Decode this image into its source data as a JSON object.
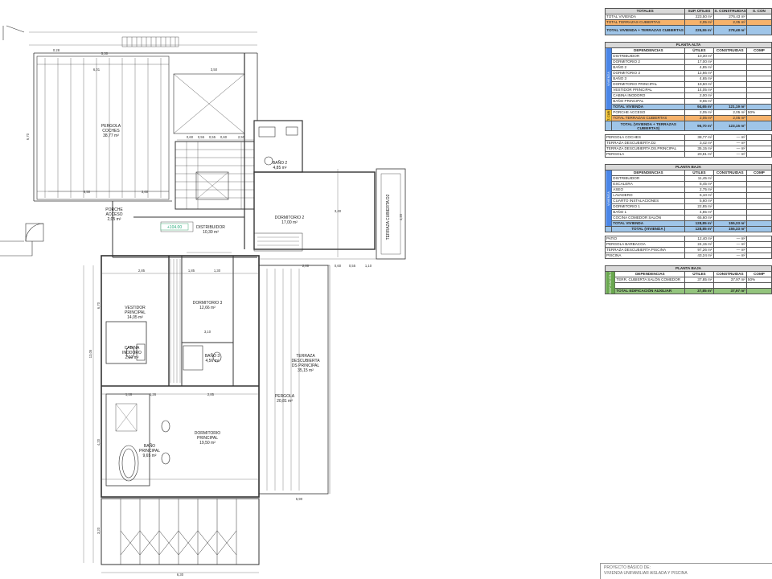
{
  "rooms": {
    "pergola_coches": {
      "name": "PERGOLA\nCOCHES",
      "area": "38,77 m²"
    },
    "porche": {
      "name": "PORCHE\nACCESO",
      "area": "2,05 m²"
    },
    "bano2": {
      "name": "BAÑO 2",
      "area": "4,85 m²"
    },
    "distribuidor": {
      "name": "DISTRIBUIDOR",
      "area": "10,30 m²"
    },
    "dorm2": {
      "name": "DORMITORIO 2",
      "area": "17,00 m²"
    },
    "terraza_cub": {
      "name": "TERRAZA CUBIERTA",
      "area": "2,05 m²"
    },
    "vestidor": {
      "name": "VESTIDOR\nPRINCIPAL",
      "area": "14,05 m²"
    },
    "dorm3": {
      "name": "DORMITORIO 3",
      "area": "12,66 m²"
    },
    "cabina": {
      "name": "CABINA\nINODORO",
      "area": "2,00 m²"
    },
    "bano3": {
      "name": "BAÑO 3",
      "area": "4,56 m²"
    },
    "terraza_desc": {
      "name": "TERRAZA\nDESCUBIERTA\nDS PRINCIPAL",
      "area": "35,15 m²"
    },
    "pergola": {
      "name": "PERGOLA",
      "area": "20,81 m²"
    },
    "dorm_ppal": {
      "name": "DORMITORIO\nPRINCIPAL",
      "area": "19,50 m²"
    },
    "bano_ppal": {
      "name": "BAÑO\nPRINCIPAL",
      "area": "9,65 m²"
    }
  },
  "level_label": "+104.00",
  "dimensions": [
    "5,30",
    "0.28",
    "6,01",
    "3,50",
    "8,50",
    "3,60",
    "1,50",
    "0,60",
    "0,55",
    "0,55",
    "0,60",
    "2,50",
    "3,40",
    "2,90",
    "1,85",
    "1,30",
    "3,10",
    "1,16",
    "1,26",
    "2,85",
    "0,94",
    "6,30",
    "4,20",
    "13,05",
    "6,70",
    "1,70",
    "2,00",
    "0,60",
    "1,10",
    "0,55",
    "8,50",
    "5,35",
    "2,50",
    "1,00",
    "1,40",
    "0,90",
    "1,15",
    "3,20",
    "0,65",
    "4,50",
    "5,90",
    "9,37"
  ],
  "summary": {
    "headers": [
      "TOTALES",
      "SUP. ÚTILES",
      "S. CONSTRUIDAS",
      "S. CON"
    ],
    "rows": [
      {
        "label": "TOTAL VIVIENDA",
        "u": "223,50 m²",
        "c": "276,43 m²",
        "style": "sub"
      },
      {
        "label": "TOTAL TERRAZAS CUBIERTAS",
        "u": "2,05 m²",
        "c": "2,05 m²",
        "style": "orange"
      },
      {
        "label": "TOTAL VIVIENDA + TERRAZAS CUBIERTAS",
        "u": "225,55 m²",
        "c": "278,48 m²",
        "style": "blue"
      }
    ]
  },
  "planta_alta": {
    "title": "PLANTA ALTA",
    "cols": [
      "DEPENDENCIAS",
      "ÚTILES",
      "CONSTRUIDAS",
      "COMP"
    ],
    "side": "VIVIENDA",
    "items": [
      {
        "n": "DISTRIBUIDOR",
        "u": "10,30 m²"
      },
      {
        "n": "DORMITORIO 2",
        "u": "17,00 m²"
      },
      {
        "n": "BAÑO 2",
        "u": "4,85 m²"
      },
      {
        "n": "DORMITORIO 3",
        "u": "12,66 m²"
      },
      {
        "n": "BAÑO 3",
        "u": "4,65 m²"
      },
      {
        "n": "DORMITORIO PRINCIPAL",
        "u": "19,50 m²"
      },
      {
        "n": "VESTIDOR PRINCIPAL",
        "u": "14,05 m²"
      },
      {
        "n": "CABINA INODORO",
        "u": "2,00 m²"
      },
      {
        "n": "BAÑO PRINCIPAL",
        "u": "9,65 m²"
      }
    ],
    "total": {
      "n": "TOTAL VIVIENDA",
      "u": "94,65 m²",
      "c": "121,19 m²"
    },
    "side2": "T. CUB",
    "porche": {
      "n": "PORCHE ACCESO",
      "u": "2,05 m²",
      "c": "2,05 m²",
      "p": "50%"
    },
    "total_terr": {
      "n": "TOTAL TERRAZAS CUBIERTAS",
      "u": "2,05 m²",
      "c": "2,05 m²"
    },
    "total_both": {
      "n": "TOTAL (VIVIENDA + TERRAZAS CUBIERTAS)",
      "u": "96,70 m²",
      "c": "123,15 m²"
    },
    "extra": [
      {
        "n": "PERGOLA COCHES",
        "u": "38,77 m²",
        "c": "— m²"
      },
      {
        "n": "TERRAZA DESCUBIERTA D2",
        "u": "3,42 m²",
        "c": "— m²"
      },
      {
        "n": "TERRAZA DESCUBIERTA DS.PRINCIPAL",
        "u": "35,15 m²",
        "c": "— m²"
      },
      {
        "n": "PERGOLA",
        "u": "20,81 m²",
        "c": "— m²"
      }
    ]
  },
  "planta_baja": {
    "title": "PLANTA BAJA",
    "cols": [
      "DEPENDENCIAS",
      "ÚTILES",
      "CONSTRUIDAS",
      "COMP"
    ],
    "side": "VIVIENDA",
    "items": [
      {
        "n": "DISTRIBUIDOR",
        "u": "11,45 m²"
      },
      {
        "n": "ESCALERA",
        "u": "8,45 m²"
      },
      {
        "n": "ASEO",
        "u": "2,75 m²"
      },
      {
        "n": "LAVADERO",
        "u": "6,10 m²"
      },
      {
        "n": "CUARTO INSTALACIONES",
        "u": "5,60 m²"
      },
      {
        "n": "DORMITORIO 1",
        "u": "22,85 m²"
      },
      {
        "n": "BAÑO 1",
        "u": "4,85 m²"
      },
      {
        "n": "COCINA COMEDOR SALÓN",
        "u": "65,60 m²"
      }
    ],
    "total": {
      "n": "TOTAL VIVIENDA",
      "u": "128,85 m²",
      "c": "155,33 m²"
    },
    "total2": {
      "n": "TOTAL (VIVIENDA )",
      "u": "128,85 m²",
      "c": "155,33 m²"
    },
    "extra": [
      {
        "n": "PATIO",
        "u": "12,40 m²",
        "c": "— m²"
      },
      {
        "n": "PERGOLA BARBACOA",
        "u": "24,15 m²",
        "c": "— m²"
      },
      {
        "n": "TERRAZA DESCUBIERTA PISCINA",
        "u": "97,26 m²",
        "c": "— m²"
      },
      {
        "n": "PISCINA",
        "u": "43,24 m²",
        "c": "— m²"
      }
    ]
  },
  "auxiliar": {
    "title": "PLANTA BAJA",
    "cols": [
      "DEPENDENCIAS",
      "ÚTILES",
      "CONSTRUIDAS",
      "COMP"
    ],
    "side": "EDIFICACIÓN AUXILIAR",
    "items": [
      {
        "n": "TERR. CUBIERTA SALÓN COMEDOR",
        "u": "37,85 m²",
        "c": "37,97 m²",
        "p": "50%"
      }
    ],
    "total": {
      "n": "TOTAL EDIFICACIÓN AUXILIAR",
      "u": "37,85 m²",
      "c": "37,97 m²"
    }
  },
  "title_block": {
    "line1": "PROYECTO BÁSICO DE:",
    "line2": "VIVIENDA UNIFAMILIAR AISLADA Y PISCINA"
  },
  "colors": {
    "blue": "#9fc5e8",
    "orange": "#f6b26b",
    "green": "#93c47d",
    "side_blue": "#4a86e8"
  }
}
